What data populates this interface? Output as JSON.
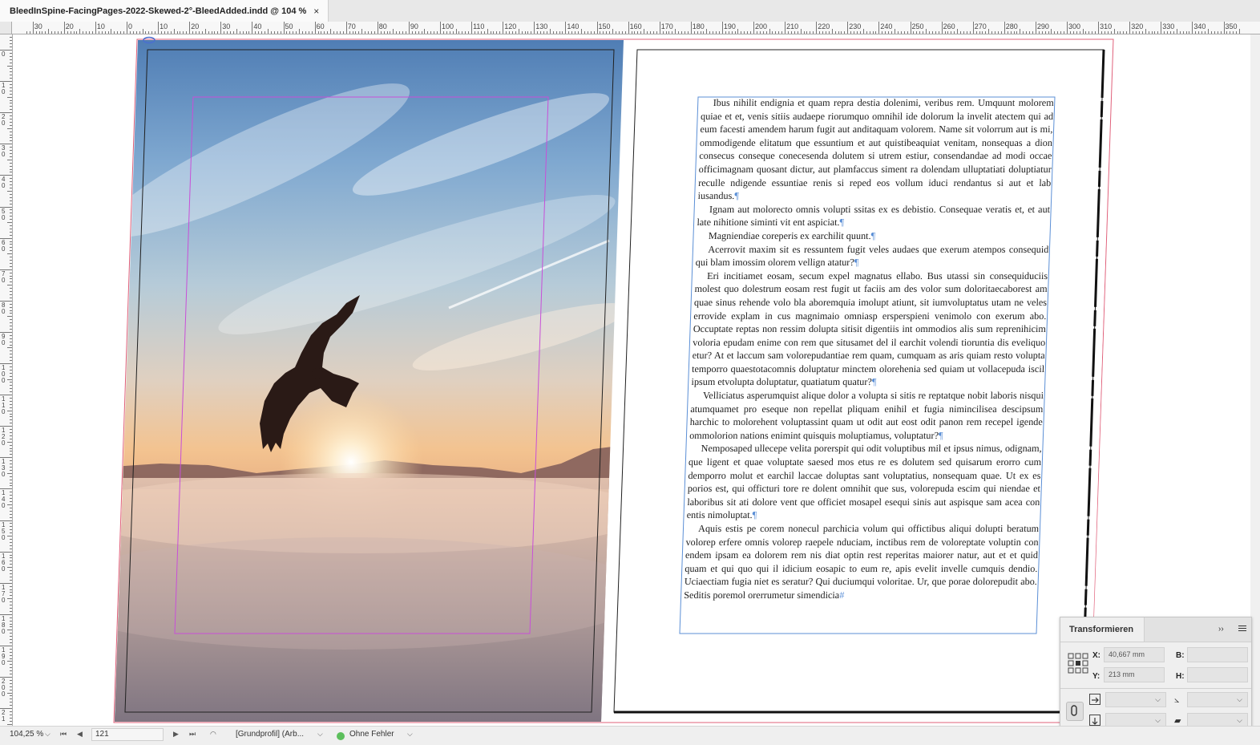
{
  "document_tab": {
    "title": "BleedInSpine-FacingPages-2022-Skewed-2°-BleedAdded.indd @ 104 %",
    "close_glyph": "×"
  },
  "ruler_top_labels": [
    "30",
    "20",
    "10",
    "0",
    "10",
    "20",
    "30",
    "40",
    "50",
    "60",
    "70",
    "80",
    "90",
    "100",
    "110",
    "120",
    "130",
    "140",
    "150",
    "160",
    "170",
    "180",
    "190",
    "200",
    "210",
    "220",
    "230",
    "240",
    "250",
    "260",
    "270",
    "280",
    "290",
    "300",
    "310",
    "320",
    "330",
    "340",
    "350"
  ],
  "ruler_left_labels": [
    "0",
    "1\n0",
    "2\n0",
    "3\n0",
    "4\n0",
    "5\n0",
    "6\n0",
    "7\n0",
    "8\n0",
    "9\n0",
    "1\n0\n0",
    "1\n1\n0",
    "1\n2\n0",
    "1\n3\n0",
    "1\n4\n0",
    "1\n5\n0",
    "1\n6\n0",
    "1\n7\n0",
    "1\n8\n0",
    "1\n9\n0",
    "2\n0\n0",
    "2\n1"
  ],
  "body_text": [
    "Ibus nihilit endignia et quam repra destia dolenimi, veribus rem. Umquunt molorem quiae et et, venis sitiis audaepe riorumquo omnihil ide dolorum la invelit atectem qui ad eum facesti amendem harum fugit aut anditaquam volorem. Name sit volorrum aut is mi, ommodigende elitatum que essuntium et aut quistibeaquiat venitam, nonsequas a dion consecus conseque conecesenda dolutem si utrem estiur, consendandae ad modi occae officimagnam quosant dictur, aut plamfaccus siment ra dolendam ulluptatiati doluptiatur reculle ndigende essuntiae renis si reped eos vollum iduci rendantus si aut et lab iusandus.",
    "Ignam aut molorecto omnis volupti ssitas ex es debistio. Consequae veratis et, et aut late nihitione siminti vit ent aspiciat.",
    "Magniendiae coreperis ex earchilit quunt.",
    "Acerrovit maxim sit es ressuntem fugit veles audaes que exerum atempos consequid qui blam imossim olorem vellign atatur?",
    "Eri incitiamet eosam, secum expel magnatus ellabo. Bus utassi sin consequiduciis molest quo dolestrum eosam rest fugit ut faciis am des volor sum doloritaecaborest am quae sinus rehende volo bla aboremquia imolupt atiunt, sit iumvoluptatus utam ne veles errovide explam in cus magnimaio omniasp ersperspieni venimolo con exerum abo. Occuptate reptas non ressim dolupta sitisit digentiis int ommodios alis sum reprenihicim voloria epudam enime con rem que situsamet del il earchit volendi tioruntia dis eveliquo etur? At et laccum sam volorepudantiae rem quam, cumquam as aris quiam resto volupta temporro quaestotacomnis doluptatur minctem olorehenia sed quiam ut vollacepuda iscil ipsum etvolupta doluptatur, quatiatum quatur?",
    "Velliciatus asperumquist alique dolor a volupta si sitis re reptatque nobit laboris nisqui atumquamet pro eseque non repellat pliquam enihil et fugia nimincilisea descipsum harchic to molorehent voluptassint quam ut odit aut eost odit panon rem recepel igende ommolorion nations enimint quisquis moluptiamus, voluptatur?",
    "Nemposaped ullecepe velita porerspit qui odit voluptibus mil et ipsus nimus, odignam, que ligent et quae voluptate saesed mos etus re es dolutem sed quisarum erorro cum demporro molut et earchil laccae doluptas sant voluptatius, nonsequam quae. Ut ex es porios est, qui offic­turi tore re dolent omnihit que sus, volorepuda escim qui niendae et laboribus sit ati dolore vent que officiet mosapel esequi sinis aut aspisque sam acea con entis nimoluptat.",
    "Aquis estis pe corem nonecul parchicia volum qui offictibus aliqui dolupti beratum volorep erfere omnis volorep raepele nduciam, inctibus rem de voloreptate voluptin con endem ipsam ea dolorem rem nis diat optin rest reperitas maiorer natur, aut et et quid quam et qui quo qui il idicium eosapic to eum re, apis evelit invelle cumquis dendio. Uciaectiam fugia niet es seratur? Qui duciumqui volo­ritae. Ur, que porae dolorepudit abo. Seditis poremol orerrumetur simendi­cia"
  ],
  "status_bar": {
    "zoom": "104,25 %",
    "page": "121",
    "profile": "[Grundprofil] (Arb...",
    "preflight": "Ohne Fehler"
  },
  "transform_panel": {
    "title": "Transformieren",
    "x_label": "X:",
    "x_value": "40,667 mm",
    "y_label": "Y:",
    "y_value": "213 mm",
    "w_label": "B:",
    "w_value": "",
    "h_label": "H:",
    "h_value": ""
  },
  "colors": {
    "frame_blue": "#5b8fd6",
    "margin_magenta": "#c84fd8",
    "bleed_red": "#e0607a",
    "status_ok": "#5cbf5c"
  }
}
